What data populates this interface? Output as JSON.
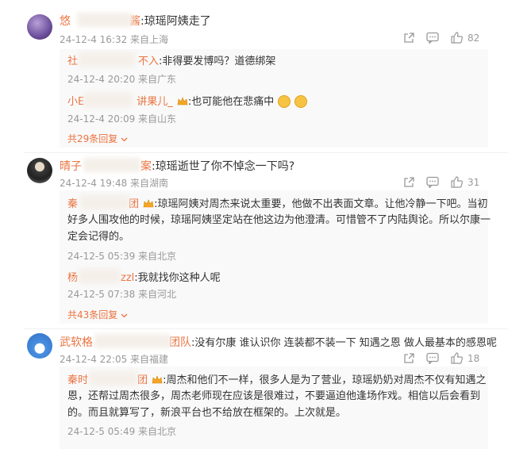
{
  "comments": [
    {
      "user": "悠",
      "user_tail": "酱",
      "text": ":琼瑶阿姨走了",
      "meta": "24-12-4 16:32 来自上海",
      "likes": "82",
      "replies": [
        {
          "user": "社",
          "user_tail": "不入",
          "text": ":非得要发博吗？道德绑架",
          "meta": "24-12-4 20:20 来自广东"
        },
        {
          "user": "小E",
          "user_tail": "讲果儿_",
          "text": ":也可能他在悲痛中",
          "meta": "24-12-4 20:09 来自山东"
        }
      ],
      "more": "共29条回复"
    },
    {
      "user": "晴子",
      "user_tail": "案",
      "text": ":琼瑶逝世了你不悼念一下吗?",
      "meta": "24-12-4 19:48 来自湖南",
      "likes": "31",
      "replies": [
        {
          "user": "秦",
          "user_tail": "团",
          "text": ":琼瑶阿姨对周杰来说太重要，他做不出表面文章。让他冷静一下吧。当初好多人围攻他的时候，琼瑶阿姨坚定站在他这边为他澄清。可惜管不了内陆舆论。所以尔康一定会记得的。",
          "meta": "24-12-5 05:39 来自北京",
          "lines": [
            "琼瑶阿姨对周杰来说太重要，他做不出表面文章。让他冷静一下吧。当初",
            "好多人围攻他的时候，琼瑶阿姨坚定站在他这边为他澄清。可惜管不了内陆舆论。所以尔康一",
            "定会记得的。"
          ]
        },
        {
          "user": "杨",
          "user_tail": "zzl",
          "text": ":我就找你这种人呢",
          "meta": "24-12-5 07:38 来自河北"
        }
      ],
      "more": "共43条回复"
    },
    {
      "user": "武软格",
      "user_tail": "团队",
      "text": ":没有尔康 谁认识你 连装都不装一下 知遇之恩 做人最基本的感恩呢",
      "meta": "24-12-4 22:05 来自福建",
      "likes": "18",
      "replies": [
        {
          "user": "秦时",
          "user_tail": "团",
          "meta": "24-12-5 05:49 来自北京",
          "lines": [
            "周杰和他们不一样，很多人是为了营业，琼瑶奶奶对周杰不仅有知遇之",
            "恩，还帮过周杰很多，周杰老师现在应该是很难过，不要逼迫他逢场作戏。相信以后会看到",
            "的。而且就算写了，新浪平台也不给放在框架的。上次就是。"
          ]
        }
      ]
    }
  ],
  "colors": {
    "username": "#eb7340",
    "meta": "#999999",
    "reply_bg": "#f9f9f9"
  },
  "icons": [
    "share-icon",
    "comment-icon",
    "like-icon",
    "crown-icon",
    "crying-emoji-icon",
    "chevron-down-icon"
  ]
}
